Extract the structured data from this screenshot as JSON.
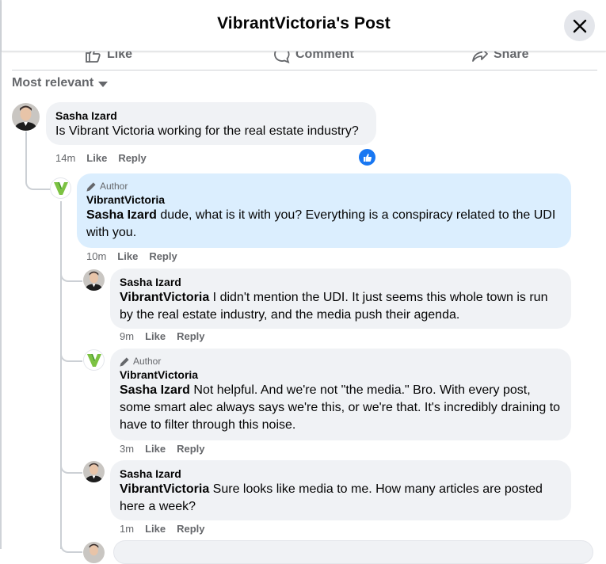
{
  "header": {
    "title": "VibrantVictoria's Post"
  },
  "actions": {
    "like": "Like",
    "comment": "Comment",
    "share": "Share"
  },
  "sort": {
    "label": "Most relevant"
  },
  "comments": [
    {
      "name": "Sasha Izard",
      "text": "Is Vibrant Victoria working for the real estate industry?",
      "time": "14m",
      "like": "Like",
      "reply": "Reply"
    },
    {
      "badge": "Author",
      "name": "VibrantVictoria",
      "mention": "Sasha Izard",
      "text": " dude, what is it with you? Everything is a conspiracy related to the UDI with you.",
      "time": "10m",
      "like": "Like",
      "reply": "Reply"
    },
    {
      "name": "Sasha Izard",
      "mention": "VibrantVictoria",
      "text": " I didn't mention the UDI. It just seems this whole town is run by the real estate industry, and the media push their agenda.",
      "time": "9m",
      "like": "Like",
      "reply": "Reply"
    },
    {
      "badge": "Author",
      "name": "VibrantVictoria",
      "mention": "Sasha Izard",
      "text": " Not helpful. And we're not \"the media.\" Bro. With every post, some smart alec always says we're this, or we're that. It's incredibly draining to have to filter through this noise.",
      "time": "3m",
      "like": "Like",
      "reply": "Reply"
    },
    {
      "name": "Sasha Izard",
      "mention": "VibrantVictoria",
      "text": " Sure looks like media to me. How many articles are posted here a week?",
      "time": "1m",
      "like": "Like",
      "reply": "Reply"
    }
  ],
  "colors": {
    "accent": "#1877f2",
    "author_highlight": "#dbeefe",
    "bubble": "#f0f2f5",
    "brand_green": "#8bc34a"
  }
}
